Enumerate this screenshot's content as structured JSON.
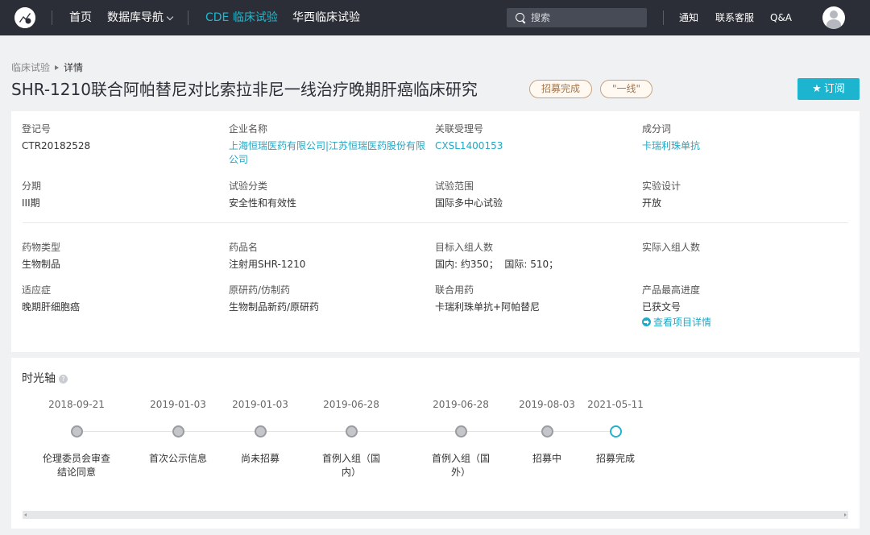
{
  "nav": {
    "logo_icon": "brand-logo-icon",
    "home": "首页",
    "db_nav": "数据库导航",
    "cde": "CDE 临床试验",
    "huaxi": "华西临床试验",
    "search_placeholder": "搜索",
    "notify": "通知",
    "support": "联系客服",
    "qa": "Q&A",
    "active_color": "#22b8cf"
  },
  "breadcrumb": {
    "parent": "临床试验",
    "current": "详情"
  },
  "header": {
    "title": "SHR-1210联合阿帕替尼对比索拉非尼一线治疗晚期肝癌临床研究",
    "tag1": "招募完成",
    "tag2": "\"一线\"",
    "subscribe_icon": "star-icon",
    "subscribe": "订阅"
  },
  "info": {
    "reg_no": {
      "label": "登记号",
      "value": "CTR20182528"
    },
    "company": {
      "label": "企业名称",
      "value": "上海恒瑞医药有限公司|江苏恒瑞医药股份有限公司"
    },
    "accept_no": {
      "label": "关联受理号",
      "value": "CXSL1400153"
    },
    "ingredient": {
      "label": "成分词",
      "value": "卡瑞利珠单抗"
    },
    "phase": {
      "label": "分期",
      "value": "III期"
    },
    "category": {
      "label": "试验分类",
      "value": "安全性和有效性"
    },
    "scope": {
      "label": "试验范围",
      "value": "国际多中心试验"
    },
    "design": {
      "label": "实验设计",
      "value": "开放"
    },
    "drug_type": {
      "label": "药物类型",
      "value": "生物制品"
    },
    "drug_name": {
      "label": "药品名",
      "value": "注射用SHR-1210"
    },
    "target_enroll": {
      "label": "目标入组人数",
      "value": "国内: 约350；  国际: 510；"
    },
    "actual_enroll": {
      "label": "实际入组人数",
      "value": ""
    },
    "indication": {
      "label": "适应症",
      "value": "晚期肝细胞癌"
    },
    "origin": {
      "label": "原研药/仿制药",
      "value": "生物制品新药/原研药"
    },
    "combo": {
      "label": "联合用药",
      "value": "卡瑞利珠单抗+阿帕替尼"
    },
    "progress": {
      "label": "产品最高进度",
      "value": "已获文号",
      "link": "查看项目详情"
    }
  },
  "timeline": {
    "title": "时光轴",
    "help_icon": "question-circle-icon",
    "events": [
      {
        "date": "2018-09-21",
        "label": "伦理委员会审查结论同意"
      },
      {
        "date": "2019-01-03",
        "label": "首次公示信息"
      },
      {
        "date": "2019-01-03",
        "label": "尚未招募"
      },
      {
        "date": "2019-06-28",
        "label": "首例入组（国内）"
      },
      {
        "date": "2019-06-28",
        "label": "首例入组（国外）"
      },
      {
        "date": "2019-08-03",
        "label": "招募中"
      },
      {
        "date": "2021-05-11",
        "label": "招募完成"
      }
    ]
  }
}
